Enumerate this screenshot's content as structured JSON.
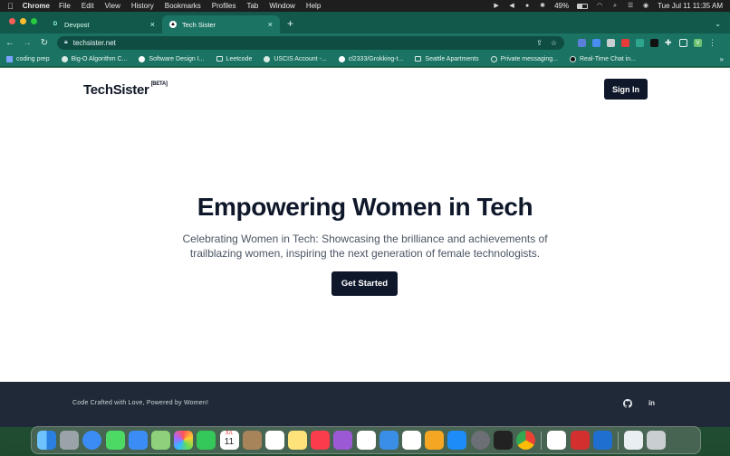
{
  "menubar": {
    "app_name": "Chrome",
    "items": [
      "File",
      "Edit",
      "View",
      "History",
      "Bookmarks",
      "Profiles",
      "Tab",
      "Window",
      "Help"
    ],
    "battery": "49%",
    "clock": "Tue Jul 11  11:35 AM"
  },
  "tabs": [
    {
      "label": "Devpost",
      "favicon": "D"
    },
    {
      "label": "Tech Sister",
      "favicon": "▲"
    }
  ],
  "address": {
    "url": "techsister.net"
  },
  "profile_initial": "V",
  "bookmarks": [
    {
      "label": "coding prep",
      "icon": "bookmark-icon"
    },
    {
      "label": "Big-O Algorithm C...",
      "icon": "globe-icon"
    },
    {
      "label": "Software Design I...",
      "icon": "video-icon"
    },
    {
      "label": "Leetcode",
      "icon": "folder-icon"
    },
    {
      "label": "USCIS Account -...",
      "icon": "seal-icon"
    },
    {
      "label": "cl2333/Grokking-t...",
      "icon": "github-icon"
    },
    {
      "label": "Seattle Apartments",
      "icon": "folder-icon"
    },
    {
      "label": "Private messaging...",
      "icon": "chat-icon"
    },
    {
      "label": "Real-Time Chat in...",
      "icon": "dot-icon"
    }
  ],
  "site": {
    "brand": "TechSister",
    "badge": "[BETA]",
    "signin_label": "Sign In",
    "hero_title": "Empowering Women in Tech",
    "hero_subtitle": "Celebrating Women in Tech: Showcasing the brilliance and achievements of trailblazing women, inspiring the next generation of female technologists.",
    "cta_label": "Get Started",
    "footer_text": "Code Crafted with Love, Powered by Women!"
  },
  "calendar_day": "11",
  "calendar_month": "JUL",
  "colors": {
    "tabstrip": "#12594c",
    "toolbar": "#1b7363",
    "dark_button": "#0f172a",
    "footer": "#1f2937"
  },
  "dock_apps": [
    "Finder",
    "Launchpad",
    "Safari",
    "Messages",
    "Mail",
    "Maps",
    "Photos",
    "FaceTime",
    "Calendar",
    "Notes-Brown",
    "Reminders",
    "Notes",
    "Music",
    "Podcasts",
    "News",
    "Keynote",
    "Numbers",
    "Pages",
    "App Store",
    "System Settings",
    "Terminal",
    "Chrome",
    "MongoDB",
    "Acrobat",
    "VS Code",
    "Preview",
    "Trash"
  ]
}
